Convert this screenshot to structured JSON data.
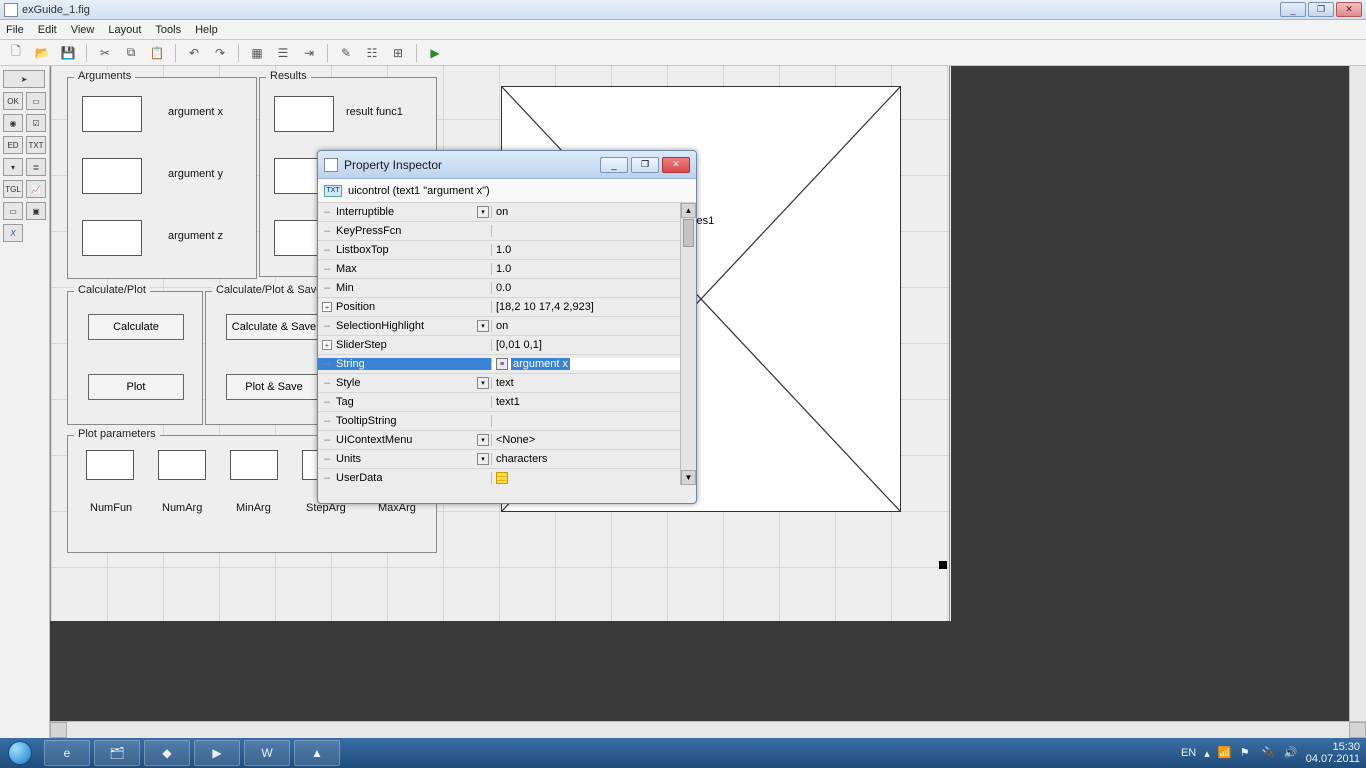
{
  "window": {
    "title": "exGuide_1.fig",
    "buttons": {
      "min": "_",
      "max": "❐",
      "close": "✕"
    }
  },
  "menu": [
    "File",
    "Edit",
    "View",
    "Layout",
    "Tools",
    "Help"
  ],
  "panels": {
    "arguments": {
      "title": "Arguments",
      "labels": [
        "argument x",
        "argument y",
        "argument z"
      ]
    },
    "results": {
      "title": "Results",
      "labels": [
        "result func1"
      ]
    },
    "calcplot": {
      "title": "Calculate/Plot",
      "buttons": [
        "Calculate",
        "Plot"
      ]
    },
    "calcplotsave": {
      "title": "Calculate/Plot & Save",
      "buttons": [
        "Calculate & Save",
        "Plot & Save"
      ]
    },
    "plotparams": {
      "title": "Plot parameters",
      "labels": [
        "NumFun",
        "NumArg",
        "MinArg",
        "StepArg",
        "MaxArg"
      ]
    }
  },
  "axes_label": "xes1",
  "inspector": {
    "title": "Property Inspector",
    "subtitle": "uicontrol (text1 \"argument x\")",
    "string_value": "argument x",
    "rows": [
      {
        "name": "Interruptible",
        "value": "on",
        "dd": true
      },
      {
        "name": "KeyPressFcn",
        "value": ""
      },
      {
        "name": "ListboxTop",
        "value": "1.0"
      },
      {
        "name": "Max",
        "value": "1.0"
      },
      {
        "name": "Min",
        "value": "0.0"
      },
      {
        "name": "Position",
        "value": "[18,2 10 17,4 2,923]",
        "exp": true
      },
      {
        "name": "SelectionHighlight",
        "value": "on",
        "dd": true
      },
      {
        "name": "SliderStep",
        "value": "[0,01 0,1]",
        "exp": true
      },
      {
        "name": "String",
        "value": "argument x",
        "selected": true,
        "editicon": true
      },
      {
        "name": "Style",
        "value": "text",
        "dd": true
      },
      {
        "name": "Tag",
        "value": "text1"
      },
      {
        "name": "TooltipString",
        "value": ""
      },
      {
        "name": "UIContextMenu",
        "value": "<None>",
        "dd": true
      },
      {
        "name": "Units",
        "value": "characters",
        "dd": true
      },
      {
        "name": "UserData",
        "value": "",
        "gridicon": true
      }
    ]
  },
  "taskbar": {
    "lang": "EN",
    "time": "15:30",
    "date": "04.07.2011"
  }
}
